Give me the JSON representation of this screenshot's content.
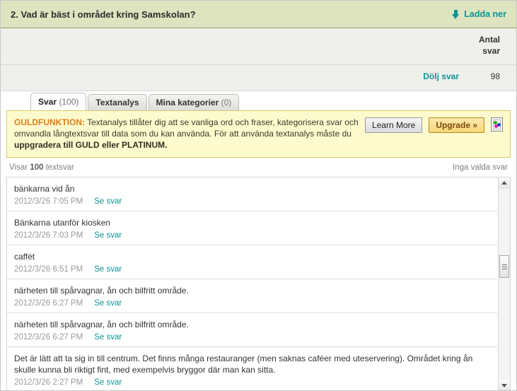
{
  "question": {
    "title": "2. Vad är bäst i området kring Samskolan?",
    "download_label": "Ladda ner",
    "download_icon": "arrow-down-icon"
  },
  "columns": {
    "antal_svar_line1": "Antal",
    "antal_svar_line2": "svar"
  },
  "subheader": {
    "hide_answers_label": "Dölj svar",
    "answer_count": "98"
  },
  "tabs": [
    {
      "label": "Svar",
      "count": "(100)",
      "active": true
    },
    {
      "label": "Textanalys",
      "count": "",
      "active": false
    },
    {
      "label": "Mina kategorier",
      "count": "(0)",
      "active": false
    }
  ],
  "gold_banner": {
    "label": "GULDFUNKTION:",
    "body": " Textanalys tillåter dig att se vanliga ord och fraser, kategorisera svar och omvandla långtextsvar till data som du kan använda. För att använda textanalys måste du ",
    "strong_tail": "uppgradera till GULD eller PLATINUM.",
    "learn_more_label": "Learn More",
    "upgrade_label": "Upgrade »",
    "image_icon": "broken-image-icon"
  },
  "list_bar": {
    "showing_prefix": "Visar ",
    "showing_count": "100",
    "showing_suffix": " textsvar",
    "selection_status": "Inga valda svar"
  },
  "responses": [
    {
      "text": "bänkarna vid ån",
      "date": "2012/3/26 7:05 PM",
      "link": "Se svar"
    },
    {
      "text": "Bänkarna utanför kiosken",
      "date": "2012/3/26 7:03 PM",
      "link": "Se svar"
    },
    {
      "text": "caffét",
      "date": "2012/3/26 6:51 PM",
      "link": "Se svar"
    },
    {
      "text": "närheten till spårvagnar, ån och bilfritt område.",
      "date": "2012/3/26 6:27 PM",
      "link": "Se svar"
    },
    {
      "text": "närheten till spårvagnar, ån och bilfritt område.",
      "date": "2012/3/26 6:27 PM",
      "link": "Se svar"
    },
    {
      "text": "Det är lätt att ta sig in till centrum. Det finns många restauranger (men saknas caféer med uteservering). Området kring ån skulle kunna bli riktigt fint, med exempelvis bryggor där man kan sitta.",
      "date": "2012/3/26 2:27 PM",
      "link": "Se svar"
    }
  ],
  "scrollbar": {
    "up_icon": "triangle-up-icon",
    "down_icon": "triangle-down-icon",
    "thumb": "scrollbar-thumb"
  },
  "colors": {
    "header_green": "#dde4bf",
    "teal_link": "#0d9494",
    "gold_banner_bg": "#fdfbcd",
    "gold_label": "#e07b17",
    "upgrade_button": "#f6d77a"
  }
}
